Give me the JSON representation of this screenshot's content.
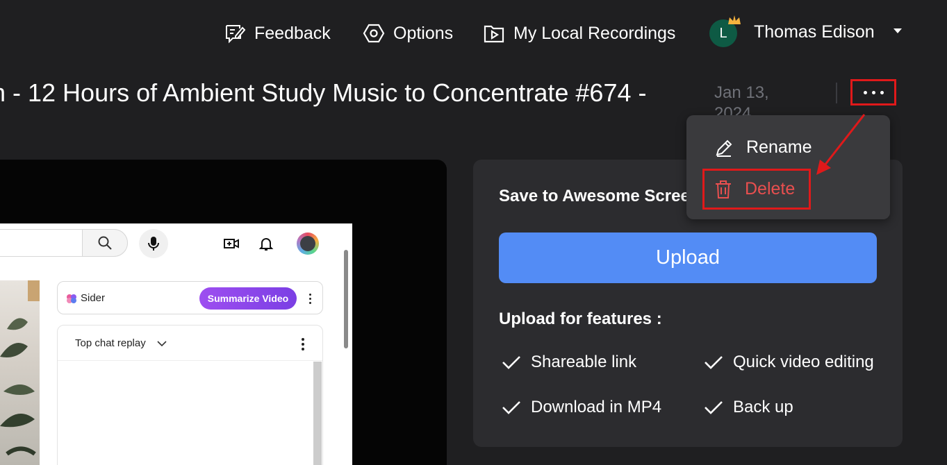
{
  "header": {
    "feedback_label": "Feedback",
    "options_label": "Options",
    "recordings_label": "My Local Recordings",
    "user": {
      "initial": "L",
      "name": "Thomas Edison"
    }
  },
  "recording": {
    "title": "n - 12 Hours of Ambient Study Music to Concentrate #674 -",
    "date": "Jan 13, 2024"
  },
  "menu": {
    "rename_label": "Rename",
    "delete_label": "Delete"
  },
  "video_preview": {
    "sider_label": "Sider",
    "summarize_label": "Summarize Video",
    "chat_header": "Top chat replay"
  },
  "panel": {
    "save_title": "Save to Awesome Screenshot",
    "upload_label": "Upload",
    "features_title": "Upload for features :",
    "features": [
      "Shareable link",
      "Quick video editing",
      "Download in MP4",
      "Back up"
    ]
  },
  "colors": {
    "background": "#1f1f21",
    "panel": "#2c2c2f",
    "upload_button": "#538cf5",
    "delete_text": "#e94f4f",
    "highlight_annotation": "#e0191a",
    "avatar": "#0e5a44"
  }
}
